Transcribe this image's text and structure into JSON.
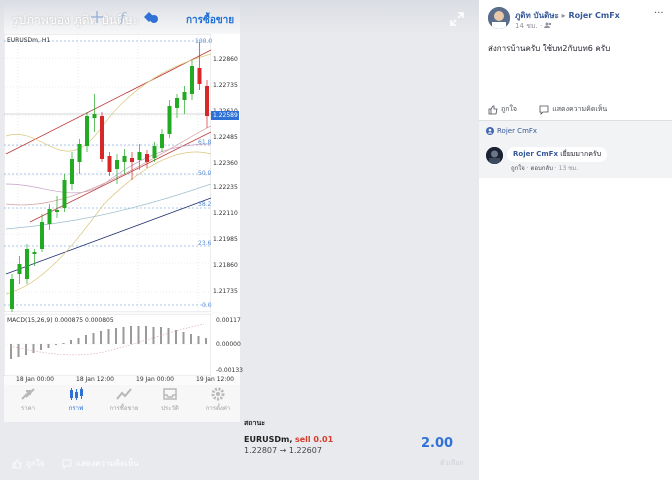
{
  "viewer": {
    "title": "รูปภาพของ ภูดิท บันดิษะ",
    "app_topbar": {
      "trade_label": "การซื้อขาย"
    },
    "chart": {
      "symbol": "EURUSDm, H1",
      "price_ticks": [
        "1.22860",
        "1.22735",
        "1.22610",
        "1.22485",
        "1.22360",
        "1.22235",
        "1.22110",
        "1.21985",
        "1.21860",
        "1.21735"
      ],
      "current_price": "1.22589",
      "fib_levels": [
        "100.0",
        "61.8",
        "50.0",
        "38.2",
        "23.6",
        "0.0"
      ],
      "macd_label": "MACD(15,26,9) 0.000875 0.000805",
      "macd_ticks": [
        "0.00117",
        "0.00000",
        "-0.00133"
      ],
      "time_ticks": [
        "18 Jan 00:00",
        "18 Jan 12:00",
        "19 Jan 00:00",
        "19 Jan 12:00"
      ]
    },
    "nav": [
      "ราคา",
      "กราฟ",
      "การซื้อขาย",
      "ประวัติ",
      "การตั้งค่า"
    ],
    "status": {
      "title": "สถานะ",
      "symbol": "EURUSDm,",
      "sell": "sell 0.01",
      "prices": "1.22807 → 1.22607",
      "value": "2.00"
    },
    "footer": {
      "like": "ถูกใจ",
      "comment": "แสดงความคิดเห็น",
      "right": "ตัวเลือก"
    }
  },
  "post": {
    "author": "ภูดิท บันดิษะ",
    "arrow": "▸",
    "group": "Rojer CmFx",
    "meta": "14 ชม. · ",
    "more": "···",
    "text": "ส่งการบ้านครับ ใช้บท2กับบท6 ครับ",
    "like": "ถูกใจ",
    "comment": "แสดงความคิดเห็น",
    "seen_by": "Rojer CmFx",
    "comment_author": "Rojer CmFx",
    "comment_text": "เยี่ยมมากครับ",
    "comment_like": "ถูกใจ",
    "comment_reply": "ตอบกลับ",
    "comment_time": "13 ชม."
  },
  "colors": {
    "accent": "#2f71d6",
    "fb_link": "#365899",
    "bull": "#22aa22",
    "bear": "#d62828"
  }
}
